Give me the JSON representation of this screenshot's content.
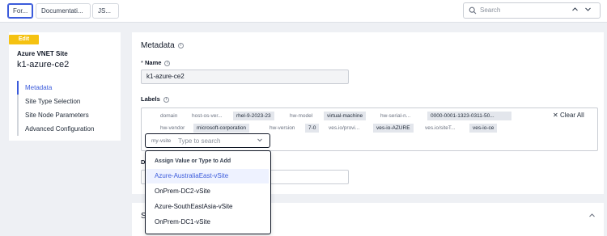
{
  "topbar": {
    "tabs": [
      {
        "label": "For..."
      },
      {
        "label": "Documentati..."
      },
      {
        "label": "JS..."
      }
    ],
    "search_placeholder": "Search"
  },
  "left": {
    "badge": "Edit",
    "site_type": "Azure VNET Site",
    "site_name": "k1-azure-ce2",
    "menu": [
      {
        "label": "Metadata",
        "active": true
      },
      {
        "label": "Site Type Selection",
        "active": false
      },
      {
        "label": "Site Node Parameters",
        "active": false
      },
      {
        "label": "Advanced Configuration",
        "active": false
      }
    ]
  },
  "metadata": {
    "title": "Metadata",
    "name_label": "Name",
    "name_value": "k1-azure-ce2",
    "labels_label": "Labels",
    "clear_all": "Clear All",
    "chips": [
      {
        "text": "domain",
        "kind": "key"
      },
      {
        "text": "host-os-ver...",
        "kind": "key"
      },
      {
        "text": "rhel-9-2023-23",
        "kind": "value"
      },
      {
        "text": "hw-model",
        "kind": "key"
      },
      {
        "text": "virtual-machine",
        "kind": "value"
      },
      {
        "text": "hw-serial-n...",
        "kind": "key"
      },
      {
        "text": "0000-0001-1323-0311-50...",
        "kind": "value"
      },
      {
        "text": "hw-vendor",
        "kind": "key"
      },
      {
        "text": "microsoft-corporation",
        "kind": "value"
      },
      {
        "text": "hw-version",
        "kind": "key"
      },
      {
        "text": "7-0",
        "kind": "value"
      },
      {
        "text": "ves.io/provi...",
        "kind": "key"
      },
      {
        "text": "ves-io-AZURE",
        "kind": "value"
      },
      {
        "text": "ves.io/siteT...",
        "kind": "key"
      },
      {
        "text": "ves-io-ce",
        "kind": "value"
      }
    ],
    "select_key": "my-vsite",
    "select_placeholder": "Type to search",
    "desc_label_partial": "D"
  },
  "dropdown": {
    "header": "Assign Value or Type to Add",
    "options": [
      "Azure-AustraliaEast-vSite",
      "OnPrem-DC2-vSite",
      "Azure-SouthEastAsia-vSite",
      "OnPrem-DC1-vSite"
    ]
  },
  "lower_card": {
    "title_partial": "S"
  },
  "colors": {
    "accent": "#3b5bdb",
    "badge": "#f5c211",
    "chip_value_bg": "#e3e6ec"
  }
}
